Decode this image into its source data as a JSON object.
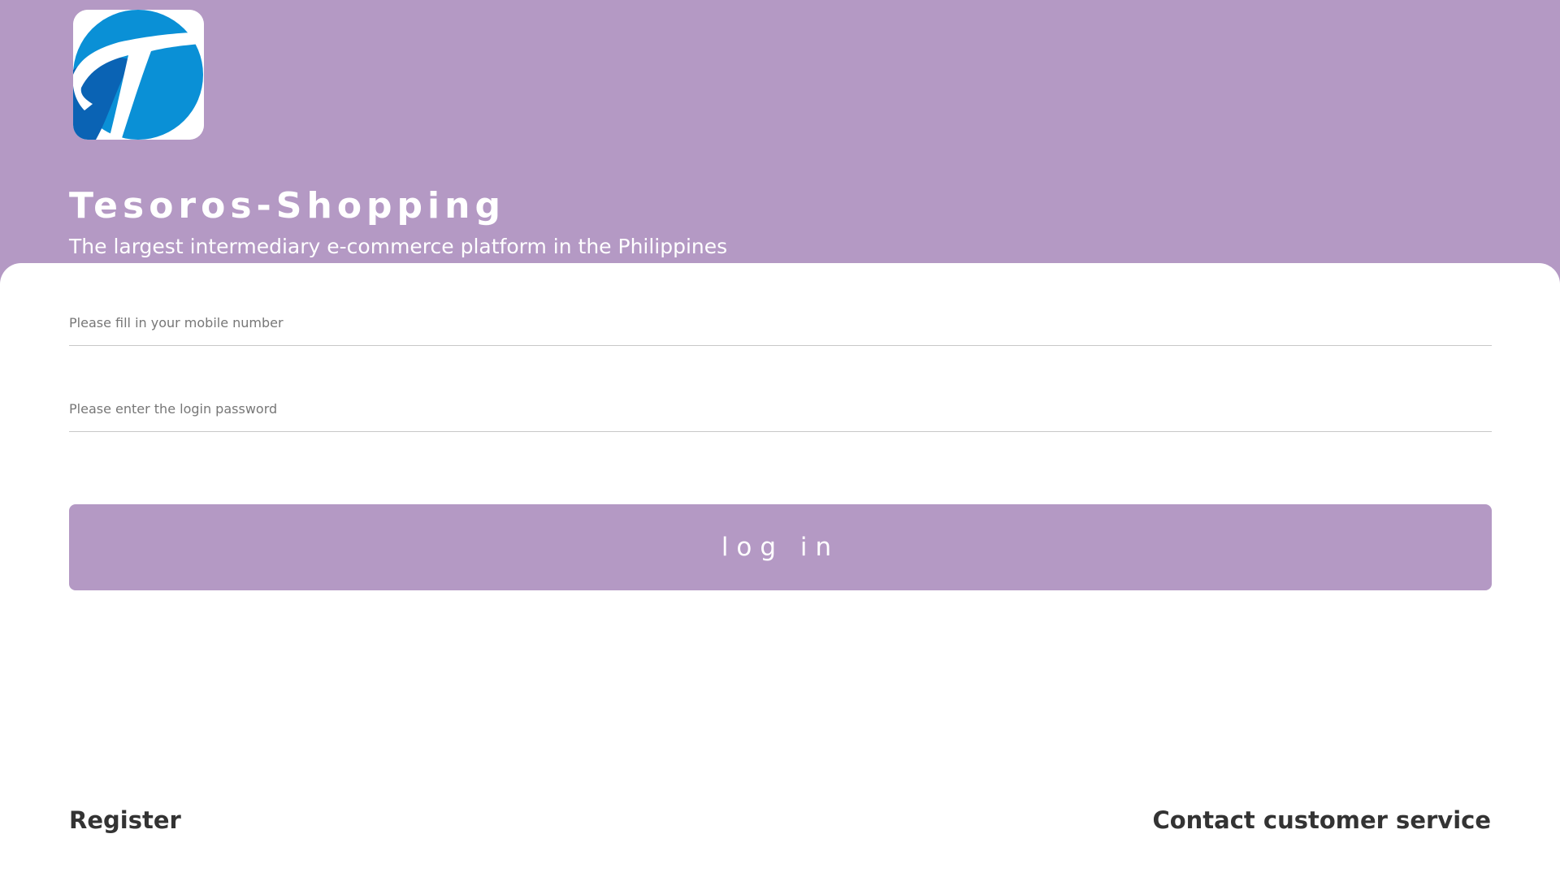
{
  "brand": {
    "logo_icon": "tesoros-t-logo-icon",
    "title": "Tesoros-Shopping",
    "subtitle": "The largest intermediary e-commerce platform in the Philippines"
  },
  "login_form": {
    "mobile_placeholder": "Please fill in your mobile number",
    "mobile_value": "",
    "password_placeholder": "Please enter the login password",
    "password_value": "",
    "submit_label": "log in"
  },
  "footer": {
    "register_label": "Register",
    "contact_label": "Contact customer service"
  },
  "colors": {
    "accent": "#b499c4",
    "card_background": "#ffffff",
    "logo_blue": "#0a90d6",
    "logo_dark_blue": "#0a63b4",
    "footer_text": "#333333"
  }
}
